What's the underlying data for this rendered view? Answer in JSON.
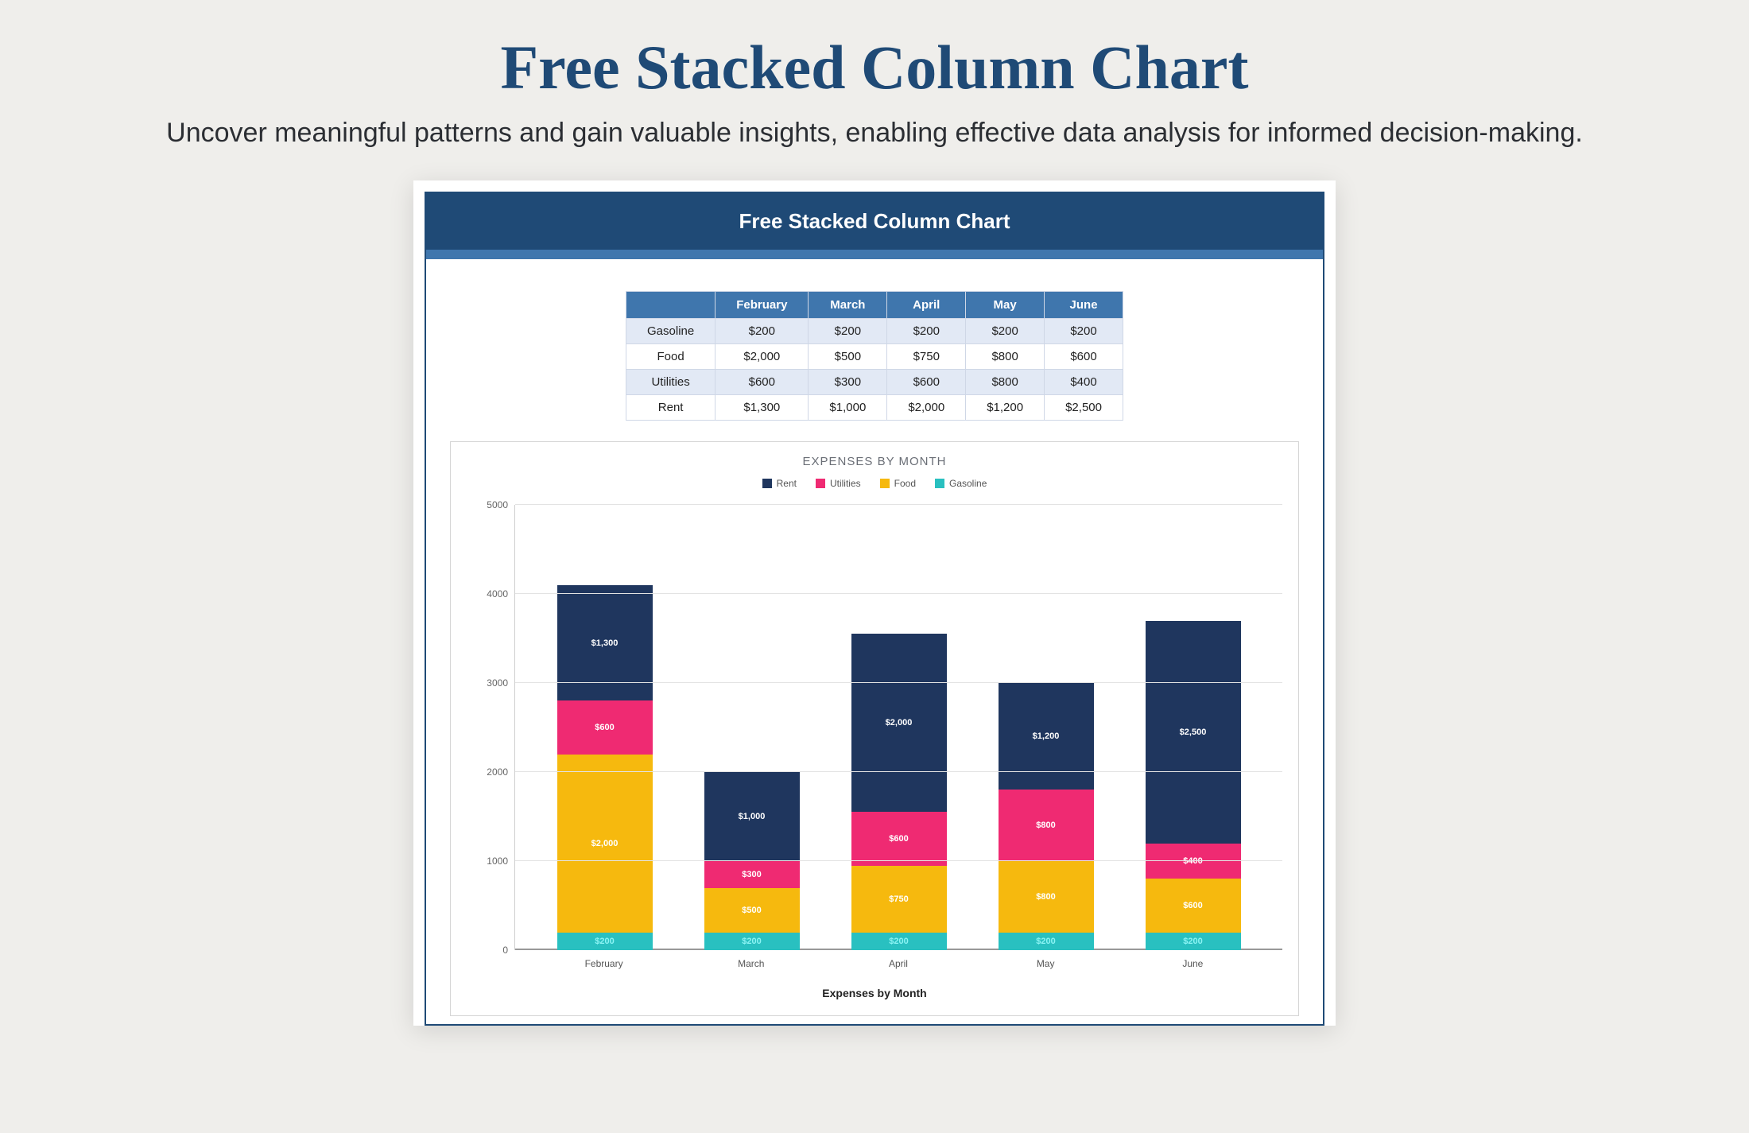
{
  "hero": {
    "title": "Free Stacked Column Chart",
    "subtitle": "Uncover meaningful patterns and gain valuable insights, enabling effective data analysis for informed decision-making."
  },
  "doc": {
    "title": "Free Stacked Column Chart"
  },
  "table": {
    "months": [
      "February",
      "March",
      "April",
      "May",
      "June"
    ],
    "rows": [
      {
        "label": "Gasoline",
        "cells": [
          "$200",
          "$200",
          "$200",
          "$200",
          "$200"
        ],
        "alt": true
      },
      {
        "label": "Food",
        "cells": [
          "$2,000",
          "$500",
          "$750",
          "$800",
          "$600"
        ],
        "alt": false
      },
      {
        "label": "Utilities",
        "cells": [
          "$600",
          "$300",
          "$600",
          "$800",
          "$400"
        ],
        "alt": true
      },
      {
        "label": "Rent",
        "cells": [
          "$1,300",
          "$1,000",
          "$2,000",
          "$1,200",
          "$2,500"
        ],
        "alt": false
      }
    ]
  },
  "chart_data": {
    "type": "bar",
    "stacked": true,
    "title": "EXPENSES BY MONTH",
    "xlabel": "Expenses by Month",
    "ylabel": "",
    "ylim": [
      0,
      5000
    ],
    "yticks": [
      0,
      1000,
      2000,
      3000,
      4000,
      5000
    ],
    "categories": [
      "February",
      "March",
      "April",
      "May",
      "June"
    ],
    "series": [
      {
        "name": "Rent",
        "color": "#1f365e",
        "values": [
          1300,
          1000,
          2000,
          1200,
          2500
        ],
        "labels": [
          "$1,300",
          "$1,000",
          "$2,000",
          "$1,200",
          "$2,500"
        ]
      },
      {
        "name": "Utilities",
        "color": "#ef2a72",
        "values": [
          600,
          300,
          600,
          800,
          400
        ],
        "labels": [
          "$600",
          "$300",
          "$600",
          "$800",
          "$400"
        ]
      },
      {
        "name": "Food",
        "color": "#f6b90e",
        "values": [
          2000,
          500,
          750,
          800,
          600
        ],
        "labels": [
          "$2,000",
          "$500",
          "$750",
          "$800",
          "$600"
        ]
      },
      {
        "name": "Gasoline",
        "color": "#29c0c0",
        "values": [
          200,
          200,
          200,
          200,
          200
        ],
        "labels": [
          "$200",
          "$200",
          "$200",
          "$200",
          "$200"
        ]
      }
    ],
    "legend_order": [
      "Rent",
      "Utilities",
      "Food",
      "Gasoline"
    ]
  }
}
